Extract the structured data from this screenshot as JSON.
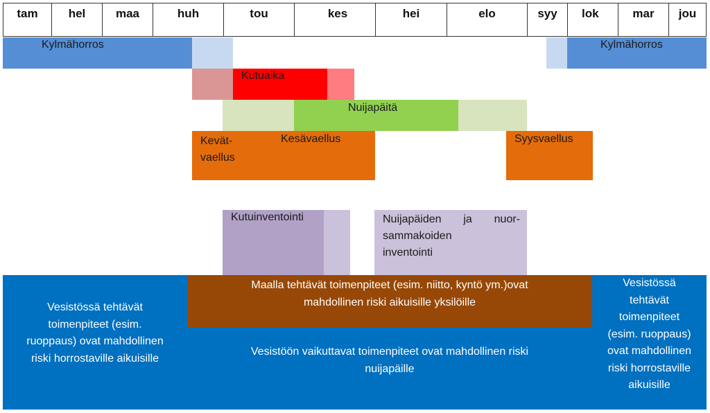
{
  "months": [
    "tam",
    "hel",
    "maa",
    "huh",
    "tou",
    "kes",
    "hei",
    "elo",
    "syy",
    "lok",
    "mar",
    "jou"
  ],
  "colors": {
    "hibernation": "#558ed5",
    "hibernation_light": "#c6d9f1",
    "spawning": "#ff0000",
    "spawning_light_early": "#d99694",
    "spawning_light_late": "#ff7c80",
    "tadpoles": "#92d050",
    "tadpoles_light": "#d7e4bd",
    "migration": "#e46c0a",
    "inventory_dark": "#b2a1c7",
    "inventory_light": "#ccc1da",
    "water_measures": "#0070c0",
    "land_measures": "#974806"
  },
  "bars": {
    "hibernation_left": "Kylmähorros",
    "hibernation_right": "Kylmähorros",
    "spawning": "Kutuaika",
    "tadpoles": "Nuijapäitä",
    "spring_migration_line1": "Kevät-",
    "spring_migration_line2": "vaellus",
    "summer_migration": "Kesävaellus",
    "autumn_migration": "Syysvaellus",
    "spawn_inventory": "Kutuinventointi",
    "tadpole_inventory_line1": "Nuijapäiden ja nuor-",
    "tadpole_inventory_line2": "sammakoiden",
    "tadpole_inventory_line3": "inventointi"
  },
  "measures": {
    "water_left": [
      "Vesistössä tehtävät",
      "toimenpiteet (esim.",
      "ruoppaus) ovat mahdollinen",
      "riski horrostaville aikuisille"
    ],
    "land_line1": "Maalla tehtävät toimenpiteet (esim. niitto, kyntö ym.)ovat",
    "land_line2": "mahdollinen riski aikuisille yksilöille",
    "water_middle_line1": "Vesistöön vaikuttavat toimenpiteet ovat mahdollinen riski",
    "water_middle_line2": "nuijapäille",
    "water_right": [
      "Vesistössä",
      "tehtävät",
      "toimenpiteet",
      "(esim. ruoppaus)",
      "ovat mahdollinen",
      "riski horrostaville",
      "aikuisille"
    ]
  }
}
